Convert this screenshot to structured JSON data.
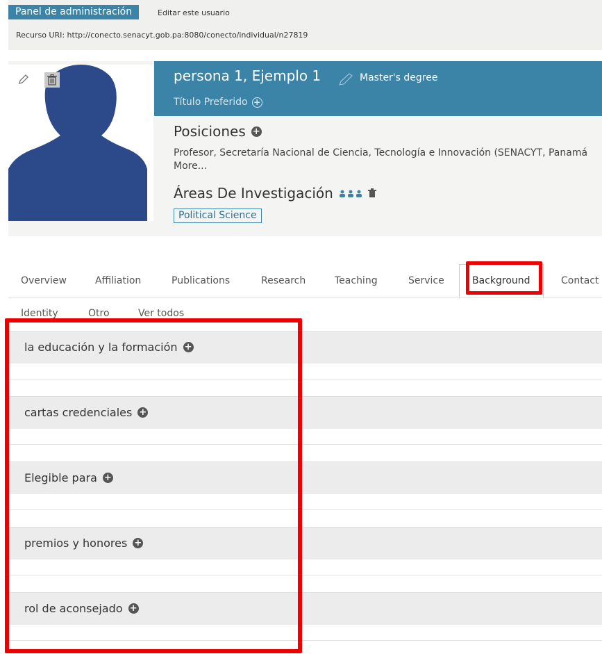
{
  "admin": {
    "title": "Panel de administración",
    "edit_link": "Editar este usuario",
    "uri_label": "Recurso URI: http://conecto.senacyt.gob.pa:8080/conecto/individual/n27819"
  },
  "profile": {
    "name": "persona 1, Ejemplo 1",
    "degree": "Master's degree",
    "preferred_title": "Título Preferido",
    "positions_heading": "Posiciones",
    "position_text": "Profesor, Secretaría Nacional de Ciencia, Tecnología e Innovación (SENACYT, Panamá",
    "more_link": "More...",
    "research_heading": "Áreas De Investigación",
    "keyword": "Political Science"
  },
  "tabs": {
    "row1": [
      "Overview",
      "Affiliation",
      "Publications",
      "Research",
      "Teaching",
      "Service",
      "Background",
      "Contact"
    ],
    "row2": [
      "Identity",
      "Otro",
      "Ver todos"
    ],
    "active": "Background"
  },
  "sections": [
    "la educación y la formación",
    "cartas credenciales",
    "Elegible para",
    "premios y honores",
    "rol de aconsejado"
  ],
  "colors": {
    "accent": "#3c83a8",
    "highlight": "#ee0000",
    "section_bg": "#ececec",
    "silhouette": "#2c4a8a"
  },
  "icons": {
    "edit": "pencil-icon",
    "delete": "trash-icon",
    "add": "plus-circle-icon",
    "manage": "people-icon"
  }
}
